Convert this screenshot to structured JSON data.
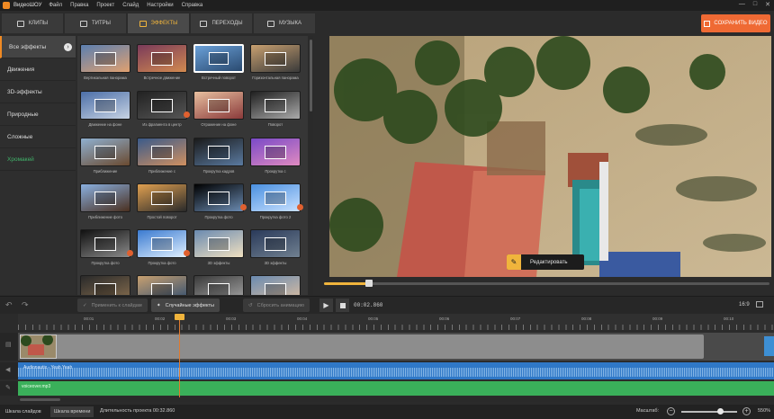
{
  "app": {
    "name": "ВидеоШОУ"
  },
  "menu": [
    "Файл",
    "Правка",
    "Проект",
    "Слайд",
    "Настройки",
    "Справка"
  ],
  "window_controls": {
    "minimize": "—",
    "maximize": "□",
    "close": "✕"
  },
  "tabs": [
    {
      "label": "КЛИПЫ",
      "icon": "clips-icon",
      "active": false
    },
    {
      "label": "ТИТРЫ",
      "icon": "titles-icon",
      "active": false
    },
    {
      "label": "ЭФФЕКТЫ",
      "icon": "effects-icon",
      "active": true
    },
    {
      "label": "ПЕРЕХОДЫ",
      "icon": "transitions-icon",
      "active": false
    },
    {
      "label": "МУЗЫКА",
      "icon": "music-icon",
      "active": false
    }
  ],
  "save_button": {
    "label": "СОХРАНИТЬ ВИДЕО",
    "color": "#ef6a34"
  },
  "sidebar": {
    "items": [
      {
        "label": "Все эффекты",
        "active": true
      },
      {
        "label": "Движения",
        "active": false
      },
      {
        "label": "3D-эффекты",
        "active": false
      },
      {
        "label": "Природные",
        "active": false
      },
      {
        "label": "Сложные",
        "active": false
      },
      {
        "label": "Хромакей",
        "active": false,
        "accent": "#41b36a"
      }
    ],
    "arrow": "›"
  },
  "effects": [
    {
      "caption": "Вертикальная панорама",
      "colors": [
        "#5b7fb0",
        "#e0a070"
      ]
    },
    {
      "caption": "Встречное движение",
      "colors": [
        "#7a3a5a",
        "#d28a50"
      ]
    },
    {
      "caption": "Встречный поворот",
      "colors": [
        "#6aa0d8",
        "#2a4a70"
      ],
      "selected": true
    },
    {
      "caption": "Горизонтальная панорама",
      "colors": [
        "#c8a070",
        "#3a3a3a"
      ]
    },
    {
      "caption": "Движение на фоне",
      "colors": [
        "#4c6fa8",
        "#c7d3e3"
      ]
    },
    {
      "caption": "Из фрагмента в центр",
      "colors": [
        "#222222",
        "#555555"
      ],
      "badge": true
    },
    {
      "caption": "Отражение на фоне",
      "colors": [
        "#e8c0a0",
        "#8a3a3a"
      ]
    },
    {
      "caption": "Поворот",
      "colors": [
        "#202020",
        "#aaaaaa"
      ]
    },
    {
      "caption": "Приближение",
      "colors": [
        "#8fb0d0",
        "#6a4a30"
      ]
    },
    {
      "caption": "Приближение с",
      "colors": [
        "#3a5a8a",
        "#d09060"
      ]
    },
    {
      "caption": "Прокрутка кадров",
      "colors": [
        "#1a1a1a",
        "#5a7aa0"
      ]
    },
    {
      "caption": "Прокрутка с",
      "colors": [
        "#7a4ac8",
        "#e08ac0"
      ]
    },
    {
      "caption": "Приближение фото",
      "colors": [
        "#8ab0e0",
        "#4a3020"
      ]
    },
    {
      "caption": "Простой поворот",
      "colors": [
        "#e0a050",
        "#2a2a2a"
      ]
    },
    {
      "caption": "Прокрутка фото",
      "colors": [
        "#000000",
        "#6a8ab0"
      ],
      "badge": true
    },
    {
      "caption": "Прокрутка фото 2",
      "colors": [
        "#4a90e0",
        "#c8e0ff"
      ],
      "badge": true
    },
    {
      "caption": "Прокрутка фото",
      "colors": [
        "#111111",
        "#8a8a8a"
      ],
      "badge": true
    },
    {
      "caption": "Прокрутка фото",
      "colors": [
        "#3a7ad0",
        "#e0f0ff"
      ],
      "badge": true
    },
    {
      "caption": "3D эффекты",
      "colors": [
        "#6a8ab0",
        "#f0e0c0"
      ]
    },
    {
      "caption": "3D эффекты",
      "colors": [
        "#2a3a5a",
        "#708090"
      ]
    },
    {
      "caption": "",
      "colors": [
        "#2a2a2a",
        "#8a7050"
      ]
    },
    {
      "caption": "",
      "colors": [
        "#c8a070",
        "#2a4a70"
      ]
    },
    {
      "caption": "",
      "colors": [
        "#3a3a3a",
        "#aaaaaa"
      ]
    },
    {
      "caption": "",
      "colors": [
        "#6a8ab0",
        "#e0c0a0"
      ]
    }
  ],
  "preview": {
    "edit_label": "Редактировать",
    "progress": 0.1
  },
  "toolbar": {
    "apply_all": "Применить к слайдам",
    "random_effects": "Случайные эффекты",
    "reset_animation": "Сбросить анимацию",
    "timecode": "00:02.860",
    "aspect_ratio": "16:9"
  },
  "ruler": [
    "00:01",
    "00:02",
    "00:03",
    "00:04",
    "00:05",
    "00:06",
    "00:07",
    "00:08",
    "00:09",
    "00:10"
  ],
  "tracks": {
    "audio_label": "Audionautix - Yeah Yeah",
    "voice_label": "voiceover.mp3"
  },
  "status": {
    "slides_scale": "Шкала слайдов",
    "timeline_scale": "Шкала времени",
    "duration": "Длительность проекта 00:32.860",
    "zoom_label": "Масштаб:",
    "zoom_value": "550%",
    "zoom_level": 0.7
  }
}
